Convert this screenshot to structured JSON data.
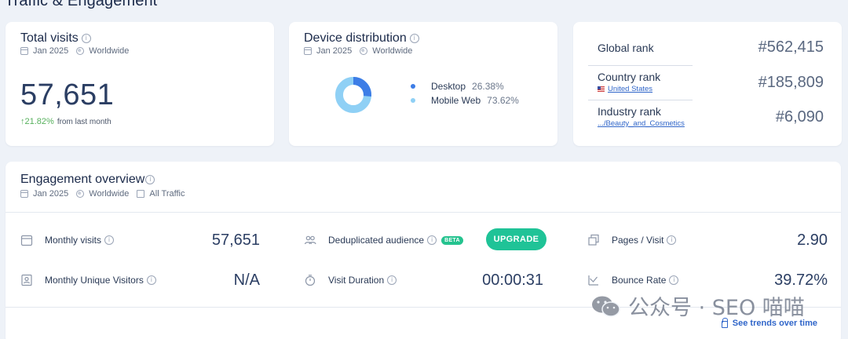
{
  "section_title": "Traffic & Engagement",
  "total_visits": {
    "title": "Total visits",
    "date": "Jan 2025",
    "region": "Worldwide",
    "value": "57,651",
    "change": "↑21.82%",
    "change_note": "from last month"
  },
  "device_distribution": {
    "title": "Device distribution",
    "date": "Jan 2025",
    "region": "Worldwide",
    "items": [
      {
        "label": "Desktop",
        "pct": "26.38%",
        "color": "#3d7de6"
      },
      {
        "label": "Mobile Web",
        "pct": "73.62%",
        "color": "#8fd0f5"
      }
    ]
  },
  "ranks": {
    "global": {
      "label": "Global rank",
      "value": "#562,415"
    },
    "country": {
      "label": "Country rank",
      "sub": "United States",
      "value": "#185,809"
    },
    "industry": {
      "label": "Industry rank",
      "sub": ".../Beauty_and_Cosmetics",
      "value": "#6,090"
    }
  },
  "engagement": {
    "title": "Engagement overview",
    "date": "Jan 2025",
    "region": "Worldwide",
    "traffic": "All Traffic",
    "metrics": {
      "monthly_visits": {
        "label": "Monthly visits",
        "value": "57,651"
      },
      "monthly_unique": {
        "label": "Monthly Unique Visitors",
        "value": "N/A"
      },
      "dedup": {
        "label": "Deduplicated audience",
        "badge": "BETA",
        "button": "UPGRADE"
      },
      "visit_duration": {
        "label": "Visit Duration",
        "value": "00:00:31"
      },
      "pages_visit": {
        "label": "Pages / Visit",
        "value": "2.90"
      },
      "bounce_rate": {
        "label": "Bounce Rate",
        "value": "39.72%"
      }
    },
    "trend_link": "See trends over time"
  },
  "watermark": "公众号 · SEO 喵喵",
  "info_glyph": "i"
}
